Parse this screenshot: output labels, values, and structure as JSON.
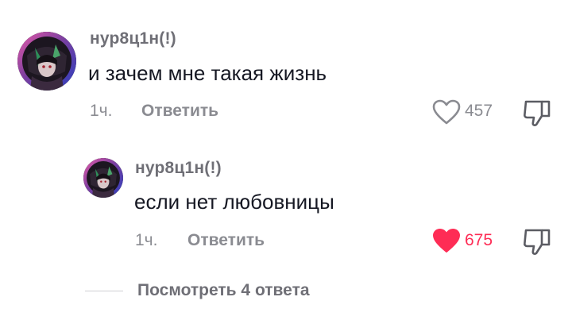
{
  "colors": {
    "liked": "#fe2c55",
    "muted": "#8a8b91",
    "text": "#161823"
  },
  "comment": {
    "username": "нур8ц1н(!)",
    "text": "и зачем мне такая жизнь",
    "time": "1ч.",
    "reply_label": "Ответить",
    "like_count": "457",
    "liked": false,
    "like_icon": "heart-outline-icon",
    "dislike_icon": "thumbs-down-icon"
  },
  "reply": {
    "username": "нур8ц1н(!)",
    "text": "если нет любовницы",
    "time": "1ч.",
    "reply_label": "Ответить",
    "like_count": "675",
    "liked": true,
    "like_icon": "heart-filled-icon",
    "dislike_icon": "thumbs-down-icon"
  },
  "view_replies": {
    "label": "Посмотреть 4 ответа"
  }
}
